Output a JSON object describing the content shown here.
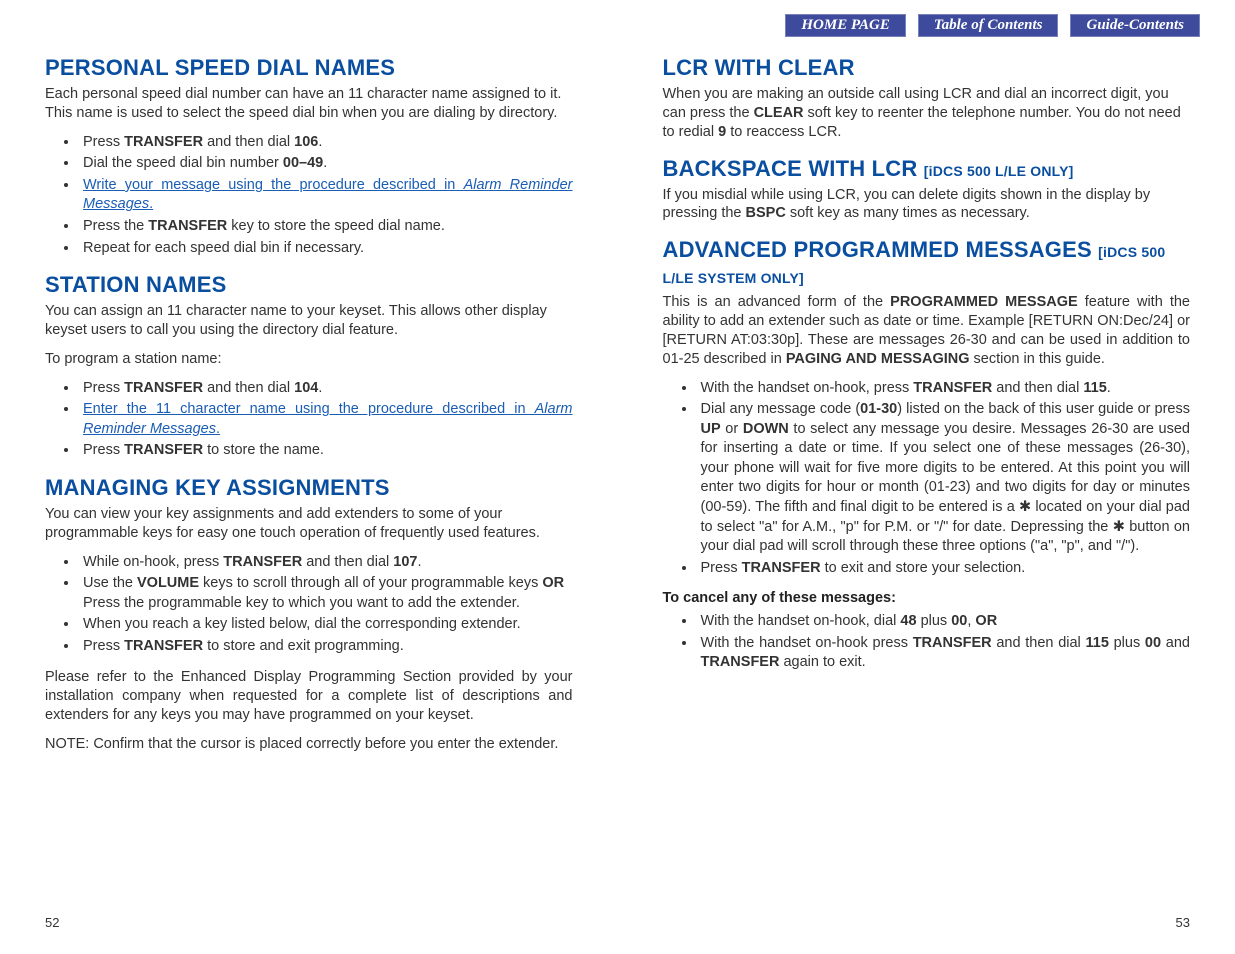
{
  "nav": {
    "home": "HOME PAGE",
    "toc": "Table of Contents",
    "guide": "Guide-Contents"
  },
  "left": {
    "h1": "PERSONAL SPEED DIAL NAMES",
    "p1": "Each personal speed dial number can have an 11 character name assigned to it. This name is used to select the speed dial bin when you are dialing by directory.",
    "b1a": "Press ",
    "b1b": "TRANSFER",
    "b1c": " and then dial ",
    "b1d": "106",
    "b1e": ".",
    "b2a": "Dial the speed dial bin number ",
    "b2b": "00–49",
    "b2c": ".",
    "b3a": "Write your message using the procedure described in ",
    "b3b": "Alarm Reminder Messages",
    "b3c": ".",
    "b4a": "Press the ",
    "b4b": "TRANSFER",
    "b4c": " key to store the speed dial name.",
    "b5": "Repeat for each speed dial bin if necessary.",
    "h2": "STATION NAMES",
    "p2": "You can assign an 11 character name to your keyset. This allows other display keyset users to call you using the directory dial feature.",
    "p3": "To program a station name:",
    "c1a": "Press ",
    "c1b": "TRANSFER",
    "c1c": " and then dial ",
    "c1d": "104",
    "c1e": ".",
    "c2a": "Enter the 11 character name using the procedure described in ",
    "c2b": "Alarm Reminder Messages",
    "c2c": ".",
    "c3a": "Press ",
    "c3b": "TRANSFER",
    "c3c": " to store the name.",
    "h3": "MANAGING KEY ASSIGNMENTS",
    "p4": "You can view your key assignments and add extenders to some of your programmable keys for easy one touch operation of frequently used features.",
    "d1a": "While on-hook, press ",
    "d1b": "TRANSFER",
    "d1c": " and then dial ",
    "d1d": "107",
    "d1e": ".",
    "d2a": "Use the ",
    "d2b": "VOLUME",
    "d2c": " keys to scroll through all of your programmable keys ",
    "d2d": "OR",
    "d2e": "Press the programmable key to which you want to add the extender.",
    "d3": "When you reach a key listed below, dial the corresponding extender.",
    "d4a": "Press ",
    "d4b": "TRANSFER",
    "d4c": " to store and exit programming.",
    "p5": "Please refer to the Enhanced Display Programming Section provided by your installation company when requested for a complete list of descriptions and extenders for any keys you may have programmed on your keyset.",
    "p6": "NOTE: Confirm that the cursor is placed correctly before you enter the extender.",
    "pg": "52"
  },
  "right": {
    "h1": "LCR WITH CLEAR",
    "p1a": "When you are making an outside call using LCR and dial an incorrect digit, you can press the ",
    "p1b": "CLEAR",
    "p1c": " soft key to reenter the telephone number. You do not need to redial ",
    "p1d": "9",
    "p1e": " to reaccess LCR.",
    "h2": "BACKSPACE WITH LCR ",
    "h2s": "[iDCS 500 L/LE ONLY]",
    "p2a": "If you misdial while using LCR, you can delete digits shown in the display by pressing the ",
    "p2b": "BSPC",
    "p2c": " soft key as many times as necessary.",
    "h3a": "ADVANCED PROGRAMMED MESSAGES ",
    "h3s": "[iDCS 500 L/LE SYSTEM ONLY]",
    "p3a": "This is an advanced form of the ",
    "p3b": "PROGRAMMED MESSAGE",
    "p3c": " feature with the ability to add an extender such as date or time. Example [RETURN ON:Dec/24] or [RETURN AT:03:30p]. These are messages 26-30 and can be used in addition to 01-25 described in ",
    "p3d": "PAGING AND MESSAGING",
    "p3e": " section in this guide.",
    "e1a": "With the handset on-hook, press ",
    "e1b": "TRANSFER",
    "e1c": " and then dial ",
    "e1d": "115",
    "e1e": ".",
    "e2a": "Dial any message code (",
    "e2b": "01-30",
    "e2c": ") listed on the back of this user guide or press ",
    "e2d": "UP",
    "e2e": " or ",
    "e2f": "DOWN",
    "e2g": " to select any message you desire. Messages 26-30 are used for inserting a date or time. If you select one of these messages (26-30), your phone will wait for five more digits to be entered. At this point you will enter two digits for hour or month (01-23) and two digits for day or minutes (00-59). The fifth and final digit to be entered is a ✱ located on your dial pad to select \"a\" for A.M., \"p\" for P.M. or \"/\" for date. Depressing the ✱ button on your dial pad will scroll through these three options (\"a\", \"p\", and \"/\").",
    "e3a": "Press ",
    "e3b": "TRANSFER",
    "e3c": " to exit and store your selection.",
    "cancel": "To cancel any of these messages:",
    "f1a": "With the handset on-hook, dial ",
    "f1b": "48",
    "f1c": " plus ",
    "f1d": "00",
    "f1e": ", ",
    "f1f": "OR",
    "f2a": "With the handset on-hook press ",
    "f2b": "TRANSFER",
    "f2c": " and then dial ",
    "f2d": "115",
    "f2e": " plus ",
    "f2f": "00",
    "f2g": " and ",
    "f2h": "TRANSFER",
    "f2i": " again to exit.",
    "pg": "53"
  }
}
